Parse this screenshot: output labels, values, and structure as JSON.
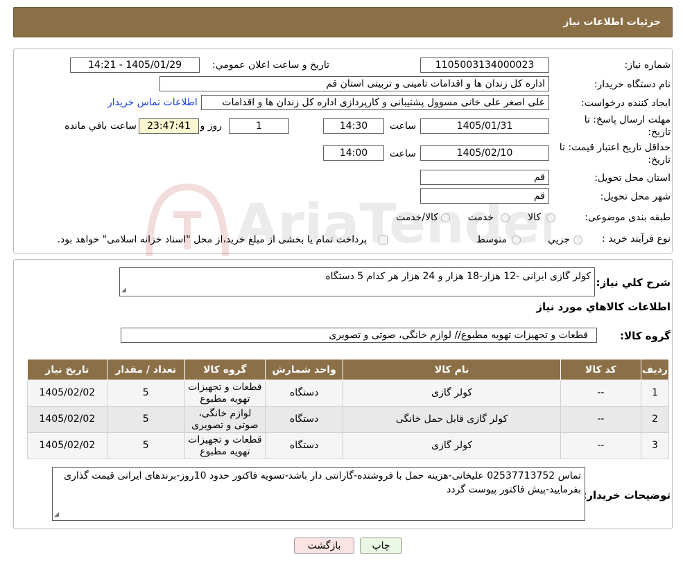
{
  "header": {
    "title": "جزئیات اطلاعات نیاز"
  },
  "form": {
    "need_number": {
      "label": "شماره نیاز:",
      "value": "1105003134000023"
    },
    "announce_datetime": {
      "label": "تاريخ و ساعت اعلان عمومي:",
      "value": "1405/01/29 - 14:21"
    },
    "buyer": {
      "label": "نام دستگاه خريدار:",
      "value": "اداره کل زندان ها و اقدامات تامینی و تربیتی استان قم"
    },
    "requester": {
      "label": "ايجاد کننده درخواست:",
      "value": "علی اصغر علی خانی مسوول پشتیبانی و کارپردازی اداره کل زندان ها و اقدامات",
      "contact_link": "اطلاعات تماس خريدار"
    },
    "deadline": {
      "label_line1": "مهلت ارسال پاسخ: تا",
      "label_line2": "تاريخ:",
      "date": "1405/01/31",
      "time_label": "ساعت",
      "time": "14:30",
      "days": "1",
      "days_label": "روز و",
      "remaining": "23:47:41",
      "remaining_label": "ساعت باقي مانده"
    },
    "validity": {
      "label_line1": "حداقل تاريخ اعتبار قيمت: تا",
      "label_line2": "تاريخ:",
      "date": "1405/02/10",
      "time_label": "ساعت",
      "time": "14:00"
    },
    "province": {
      "label": "استان محل تحويل:",
      "value": "قم"
    },
    "city": {
      "label": "شهر محل تحويل:",
      "value": "قم"
    },
    "category": {
      "label": "طبقه بندی موضوعی:",
      "options": [
        "کالا",
        "خدمت",
        "کالا/خدمت"
      ]
    },
    "process": {
      "label": "نوع فرآيند خريد :",
      "options": [
        "جزيي",
        "متوسط"
      ],
      "note": "پرداخت تمام يا بخشی از مبلغ خريد،از محل \"اسناد خزانه اسلامی\" خواهد بود."
    }
  },
  "summary": {
    "label": "شرح کلي نياز:",
    "value": "کولر گازی ایرانی -12 هزار-18 هزار و 24 هزار هر کدام 5 دستگاه"
  },
  "goods_section": {
    "title": "اطلاعات کالاهاي مورد نياز",
    "group_label": "گروه کالا:",
    "group_value": "قطعات و تجهیزات تهویه مطبوع// لوازم خانگی، صوتی و تصویری"
  },
  "table": {
    "headers": [
      "رديف",
      "کد کالا",
      "نام کالا",
      "واحد شمارش",
      "گروه کالا",
      "تعداد / مقدار",
      "تاريخ نياز"
    ],
    "rows": [
      {
        "row": "1",
        "code": "--",
        "name": "کولر گازی",
        "unit": "دستگاه",
        "group": "قطعات و تجهیزات تهویه مطبوع",
        "qty": "5",
        "date": "1405/02/02"
      },
      {
        "row": "2",
        "code": "--",
        "name": "کولر گازی قابل حمل خانگی",
        "unit": "دستگاه",
        "group": "لوازم خانگی، صوتی و تصویری",
        "qty": "5",
        "date": "1405/02/02"
      },
      {
        "row": "3",
        "code": "--",
        "name": "کولر گازی",
        "unit": "دستگاه",
        "group": "قطعات و تجهیزات تهویه مطبوع",
        "qty": "5",
        "date": "1405/02/02"
      }
    ]
  },
  "buyer_notes": {
    "label": "توضيحات خريدار:",
    "value": "تماس 02537713752 علیخانی-هزینه حمل با فروشنده-گارانتی دار باشد-تسویه فاکتور حدود 10روز-برندهای ایرانی قیمت گذاری بفرمایید-پیش فاکتور پیوست گردد"
  },
  "buttons": {
    "print": "چاپ",
    "back": "بازگشت"
  },
  "watermark": {
    "text": "AriaTender.neT"
  },
  "colors": {
    "header_bg": "#8b6f47",
    "link": "#1a3fd8",
    "back_btn": "#fbe3e3",
    "print_btn": "#eaf7e3"
  }
}
